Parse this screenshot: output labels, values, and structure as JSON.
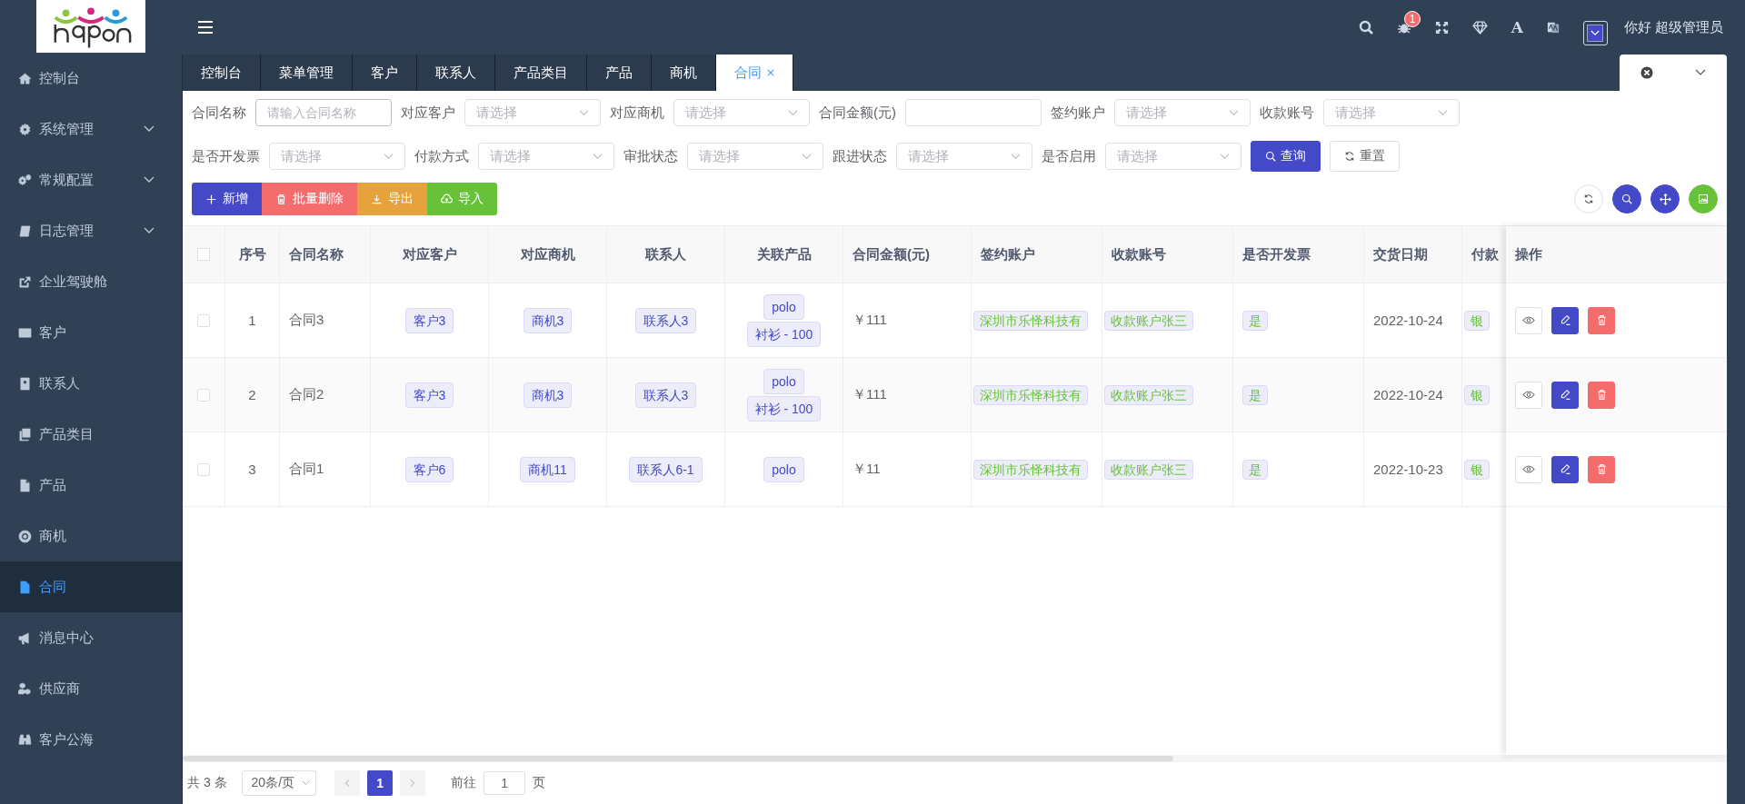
{
  "header": {
    "badge": "1",
    "font_glyph": "A",
    "greeting": "你好 超级管理员"
  },
  "sidebar": {
    "items": [
      {
        "label": "控制台",
        "has_submenu": false,
        "selected": false
      },
      {
        "label": "系统管理",
        "has_submenu": true,
        "selected": false
      },
      {
        "label": "常规配置",
        "has_submenu": true,
        "selected": false
      },
      {
        "label": "日志管理",
        "has_submenu": true,
        "selected": false
      },
      {
        "label": "企业驾驶舱",
        "has_submenu": false,
        "selected": false
      },
      {
        "label": "客户",
        "has_submenu": false,
        "selected": false
      },
      {
        "label": "联系人",
        "has_submenu": false,
        "selected": false
      },
      {
        "label": "产品类目",
        "has_submenu": false,
        "selected": false
      },
      {
        "label": "产品",
        "has_submenu": false,
        "selected": false
      },
      {
        "label": "商机",
        "has_submenu": false,
        "selected": false
      },
      {
        "label": "合同",
        "has_submenu": false,
        "selected": true
      },
      {
        "label": "消息中心",
        "has_submenu": false,
        "selected": false
      },
      {
        "label": "供应商",
        "has_submenu": false,
        "selected": false
      },
      {
        "label": "客户公海",
        "has_submenu": false,
        "selected": false
      }
    ]
  },
  "tabs": [
    {
      "label": "控制台",
      "selected": false,
      "closable": false
    },
    {
      "label": "菜单管理",
      "selected": false,
      "closable": false
    },
    {
      "label": "客户",
      "selected": false,
      "closable": false
    },
    {
      "label": "联系人",
      "selected": false,
      "closable": false
    },
    {
      "label": "产品类目",
      "selected": false,
      "closable": false
    },
    {
      "label": "产品",
      "selected": false,
      "closable": false
    },
    {
      "label": "商机",
      "selected": false,
      "closable": false
    },
    {
      "label": "合同",
      "selected": true,
      "closable": true
    }
  ],
  "filters": {
    "rows": [
      [
        {
          "label": "合同名称",
          "kind": "input",
          "placeholder": "请输入合同名称"
        },
        {
          "label": "对应客户",
          "kind": "select",
          "placeholder": "请选择"
        },
        {
          "label": "对应商机",
          "kind": "select",
          "placeholder": "请选择"
        },
        {
          "label": "合同金额(元)",
          "kind": "input"
        },
        {
          "label": "签约账户",
          "kind": "select",
          "placeholder": "请选择"
        },
        {
          "label": "收款账号",
          "kind": "select",
          "placeholder": "请选择"
        }
      ],
      [
        {
          "label": "是否开发票",
          "kind": "select",
          "placeholder": "请选择"
        },
        {
          "label": "付款方式",
          "kind": "select",
          "placeholder": "请选择"
        },
        {
          "label": "审批状态",
          "kind": "select",
          "placeholder": "请选择"
        },
        {
          "label": "跟进状态",
          "kind": "select",
          "placeholder": "请选择"
        },
        {
          "label": "是否启用",
          "kind": "select",
          "placeholder": "请选择"
        }
      ]
    ],
    "buttons": [
      {
        "label": "查询",
        "kind": "primary"
      },
      {
        "label": "重置",
        "kind": "plain"
      }
    ]
  },
  "actions": [
    {
      "label": "新增",
      "kind": "add"
    },
    {
      "label": "批量删除",
      "kind": "delete"
    },
    {
      "label": "导出",
      "kind": "export"
    },
    {
      "label": "导入",
      "kind": "import"
    }
  ],
  "table": {
    "columns": [
      "序号",
      "合同名称",
      "对应客户",
      "对应商机",
      "联系人",
      "关联产品",
      "合同金额(元)",
      "签约账户",
      "收款账号",
      "是否开发票",
      "交货日期",
      "付款"
    ],
    "ops_header": "操作",
    "select_all_checked": false,
    "rows": [
      {
        "checked": false,
        "index": "1",
        "name": "合同3",
        "customer": "客户3",
        "opportunity": "商机3",
        "contact": "联系人3",
        "products": [
          "polo",
          "衬衫 - 100"
        ],
        "amount": "￥111",
        "account": "深圳市乐怿科技有",
        "receiving": "收款账户张三",
        "invoice": "是",
        "date": "2022-10-24",
        "payment": "银"
      },
      {
        "checked": false,
        "index": "2",
        "name": "合同2",
        "customer": "客户3",
        "opportunity": "商机3",
        "contact": "联系人3",
        "products": [
          "polo",
          "衬衫 - 100"
        ],
        "amount": "￥111",
        "account": "深圳市乐怿科技有",
        "receiving": "收款账户张三",
        "invoice": "是",
        "date": "2022-10-24",
        "payment": "银"
      },
      {
        "checked": false,
        "index": "3",
        "name": "合同1",
        "customer": "客户6",
        "opportunity": "商机11",
        "contact": "联系人6-1",
        "products": [
          "polo"
        ],
        "amount": "￥11",
        "account": "深圳市乐怿科技有",
        "receiving": "收款账户张三",
        "invoice": "是",
        "date": "2022-10-23",
        "payment": "银"
      }
    ]
  },
  "pager": {
    "total": "共 3 条",
    "page_size": "20条/页",
    "pages": [
      {
        "label": "1",
        "selected": true
      }
    ],
    "goto_label": "前往",
    "goto_value": "1",
    "goto_suffix": "页"
  }
}
